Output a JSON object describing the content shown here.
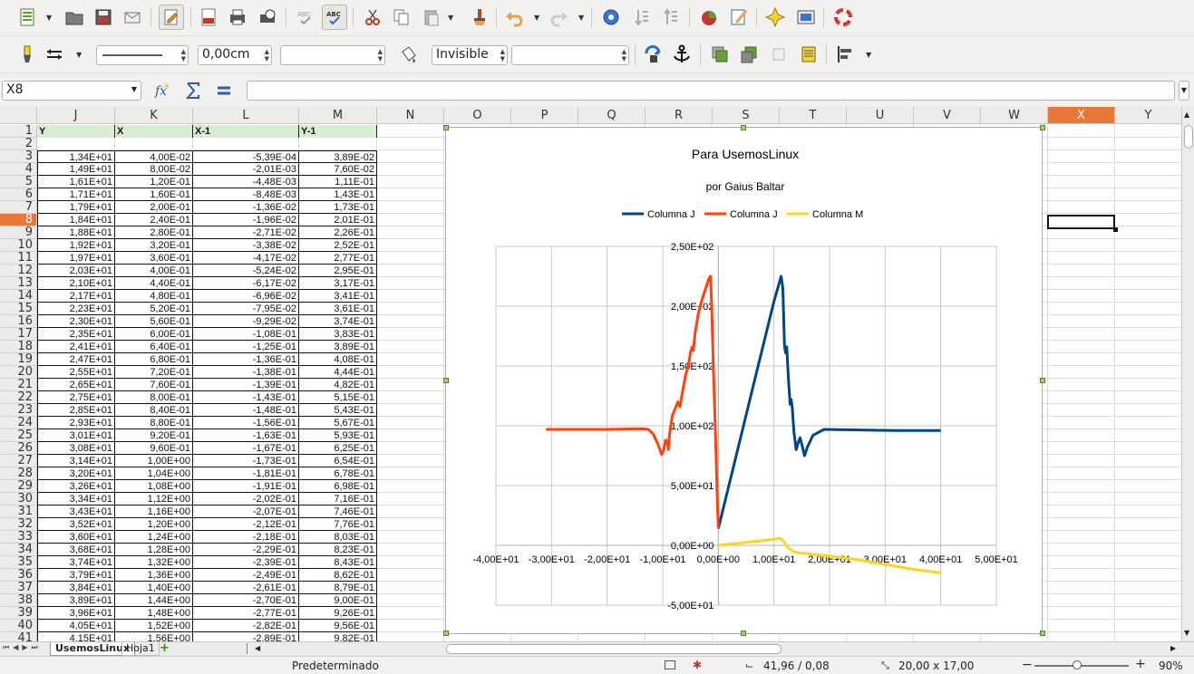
{
  "toolbar1": {
    "icons": [
      "new-document-icon",
      "open-folder-icon",
      "save-icon",
      "email-icon",
      "edit-file-icon",
      "export-pdf-icon",
      "print-icon",
      "print-preview-icon",
      "spellcheck-icon",
      "autospell-icon",
      "cut-icon",
      "copy-icon",
      "paste-icon",
      "format-paintbrush-icon",
      "undo-icon",
      "redo-icon",
      "navigator-icon",
      "sort-ascending-icon",
      "sort-descending-icon",
      "chart-icon",
      "draw-functions-icon",
      "star-gallery-icon",
      "data-sources-icon",
      "help-lifebuoy-icon"
    ]
  },
  "toolbar2": {
    "line_style_value": "",
    "line_width_value": "0,00cm",
    "line_color_value": "",
    "area_style_value": "Invisible",
    "area_fill_value": ""
  },
  "formula": {
    "name_box": "X8",
    "content": ""
  },
  "columns": [
    "J",
    "K",
    "L",
    "M",
    "N",
    "O",
    "P",
    "Q",
    "R",
    "S",
    "T",
    "U",
    "V",
    "W",
    "X",
    "Y"
  ],
  "selected_column": "X",
  "selected_row": "8",
  "headers": {
    "J": "Y",
    "K": "X",
    "L": "X-1",
    "M": "Y-1"
  },
  "rows": [
    {
      "r": "1"
    },
    {
      "r": "2"
    },
    {
      "r": "3",
      "J": "1,34E+01",
      "K": "4,00E-02",
      "L": "-5,39E-04",
      "M": "3,89E-02"
    },
    {
      "r": "4",
      "J": "1,49E+01",
      "K": "8,00E-02",
      "L": "-2,01E-03",
      "M": "7,60E-02"
    },
    {
      "r": "5",
      "J": "1,61E+01",
      "K": "1,20E-01",
      "L": "-4,48E-03",
      "M": "1,11E-01"
    },
    {
      "r": "6",
      "J": "1,71E+01",
      "K": "1,60E-01",
      "L": "-8,48E-03",
      "M": "1,43E-01"
    },
    {
      "r": "7",
      "J": "1,79E+01",
      "K": "2,00E-01",
      "L": "-1,36E-02",
      "M": "1,73E-01"
    },
    {
      "r": "8",
      "J": "1,84E+01",
      "K": "2,40E-01",
      "L": "-1,96E-02",
      "M": "2,01E-01"
    },
    {
      "r": "9",
      "J": "1,88E+01",
      "K": "2,80E-01",
      "L": "-2,71E-02",
      "M": "2,26E-01"
    },
    {
      "r": "10",
      "J": "1,92E+01",
      "K": "3,20E-01",
      "L": "-3,38E-02",
      "M": "2,52E-01"
    },
    {
      "r": "11",
      "J": "1,97E+01",
      "K": "3,60E-01",
      "L": "-4,17E-02",
      "M": "2,77E-01"
    },
    {
      "r": "12",
      "J": "2,03E+01",
      "K": "4,00E-01",
      "L": "-5,24E-02",
      "M": "2,95E-01"
    },
    {
      "r": "13",
      "J": "2,10E+01",
      "K": "4,40E-01",
      "L": "-6,17E-02",
      "M": "3,17E-01"
    },
    {
      "r": "14",
      "J": "2,17E+01",
      "K": "4,80E-01",
      "L": "-6,96E-02",
      "M": "3,41E-01"
    },
    {
      "r": "15",
      "J": "2,23E+01",
      "K": "5,20E-01",
      "L": "-7,95E-02",
      "M": "3,61E-01"
    },
    {
      "r": "16",
      "J": "2,30E+01",
      "K": "5,60E-01",
      "L": "-9,29E-02",
      "M": "3,74E-01"
    },
    {
      "r": "17",
      "J": "2,35E+01",
      "K": "6,00E-01",
      "L": "-1,08E-01",
      "M": "3,83E-01"
    },
    {
      "r": "18",
      "J": "2,41E+01",
      "K": "6,40E-01",
      "L": "-1,25E-01",
      "M": "3,89E-01"
    },
    {
      "r": "19",
      "J": "2,47E+01",
      "K": "6,80E-01",
      "L": "-1,36E-01",
      "M": "4,08E-01"
    },
    {
      "r": "20",
      "J": "2,55E+01",
      "K": "7,20E-01",
      "L": "-1,38E-01",
      "M": "4,44E-01"
    },
    {
      "r": "21",
      "J": "2,65E+01",
      "K": "7,60E-01",
      "L": "-1,39E-01",
      "M": "4,82E-01"
    },
    {
      "r": "22",
      "J": "2,75E+01",
      "K": "8,00E-01",
      "L": "-1,43E-01",
      "M": "5,15E-01"
    },
    {
      "r": "23",
      "J": "2,85E+01",
      "K": "8,40E-01",
      "L": "-1,48E-01",
      "M": "5,43E-01"
    },
    {
      "r": "24",
      "J": "2,93E+01",
      "K": "8,80E-01",
      "L": "-1,56E-01",
      "M": "5,67E-01"
    },
    {
      "r": "25",
      "J": "3,01E+01",
      "K": "9,20E-01",
      "L": "-1,63E-01",
      "M": "5,93E-01"
    },
    {
      "r": "26",
      "J": "3,08E+01",
      "K": "9,60E-01",
      "L": "-1,67E-01",
      "M": "6,25E-01"
    },
    {
      "r": "27",
      "J": "3,14E+01",
      "K": "1,00E+00",
      "L": "-1,73E-01",
      "M": "6,54E-01"
    },
    {
      "r": "28",
      "J": "3,20E+01",
      "K": "1,04E+00",
      "L": "-1,81E-01",
      "M": "6,78E-01"
    },
    {
      "r": "29",
      "J": "3,26E+01",
      "K": "1,08E+00",
      "L": "-1,91E-01",
      "M": "6,98E-01"
    },
    {
      "r": "30",
      "J": "3,34E+01",
      "K": "1,12E+00",
      "L": "-2,02E-01",
      "M": "7,16E-01"
    },
    {
      "r": "31",
      "J": "3,43E+01",
      "K": "1,16E+00",
      "L": "-2,07E-01",
      "M": "7,46E-01"
    },
    {
      "r": "32",
      "J": "3,52E+01",
      "K": "1,20E+00",
      "L": "-2,12E-01",
      "M": "7,76E-01"
    },
    {
      "r": "33",
      "J": "3,60E+01",
      "K": "1,24E+00",
      "L": "-2,18E-01",
      "M": "8,03E-01"
    },
    {
      "r": "34",
      "J": "3,68E+01",
      "K": "1,28E+00",
      "L": "-2,29E-01",
      "M": "8,23E-01"
    },
    {
      "r": "35",
      "J": "3,74E+01",
      "K": "1,32E+00",
      "L": "-2,39E-01",
      "M": "8,43E-01"
    },
    {
      "r": "36",
      "J": "3,79E+01",
      "K": "1,36E+00",
      "L": "-2,49E-01",
      "M": "8,62E-01"
    },
    {
      "r": "37",
      "J": "3,84E+01",
      "K": "1,40E+00",
      "L": "-2,61E-01",
      "M": "8,79E-01"
    },
    {
      "r": "38",
      "J": "3,89E+01",
      "K": "1,44E+00",
      "L": "-2,70E-01",
      "M": "9,00E-01"
    },
    {
      "r": "39",
      "J": "3,96E+01",
      "K": "1,48E+00",
      "L": "-2,77E-01",
      "M": "9,26E-01"
    },
    {
      "r": "40",
      "J": "4,05E+01",
      "K": "1,52E+00",
      "L": "-2,82E-01",
      "M": "9,56E-01"
    },
    {
      "r": "41",
      "J": "4,15E+01",
      "K": "1,56E+00",
      "L": "-2,89E-01",
      "M": "9,82E-01"
    }
  ],
  "chart_data": {
    "type": "line",
    "title": "Para UsemosLinux",
    "subtitle": "por Gaius Baltar",
    "legend_position": "top",
    "xlim": [
      -40,
      50
    ],
    "ylim": [
      -50,
      250
    ],
    "x_ticks": [
      "-4,00E+01",
      "-3,00E+01",
      "-2,00E+01",
      "-1,00E+01",
      "0,00E+00",
      "1,00E+01",
      "2,00E+01",
      "3,00E+01",
      "4,00E+01",
      "5,00E+01"
    ],
    "y_ticks": [
      "-5,00E+01",
      "0,00E+00",
      "5,00E+01",
      "1,00E+02",
      "1,50E+02",
      "2,00E+02",
      "2,50E+02"
    ],
    "grid": true,
    "series": [
      {
        "name": "Columna J",
        "color": "#004586",
        "points": [
          [
            0,
            14
          ],
          [
            2,
            52
          ],
          [
            4,
            90
          ],
          [
            6,
            128
          ],
          [
            8,
            166
          ],
          [
            10,
            204
          ],
          [
            11.3,
            225
          ],
          [
            11.6,
            215
          ],
          [
            11.9,
            167
          ],
          [
            12.1,
            161
          ],
          [
            12.3,
            166
          ],
          [
            12.6,
            140
          ],
          [
            12.9,
            118
          ],
          [
            13.1,
            122
          ],
          [
            13.3,
            115
          ],
          [
            13.6,
            95
          ],
          [
            14,
            80
          ],
          [
            14.3,
            85
          ],
          [
            14.7,
            90
          ],
          [
            15.1,
            83
          ],
          [
            15.5,
            75
          ],
          [
            16,
            82
          ],
          [
            17,
            92
          ],
          [
            19,
            97
          ],
          [
            25,
            96.5
          ],
          [
            32,
            96
          ],
          [
            40,
            96
          ]
        ]
      },
      {
        "name": "Columna J",
        "color": "#ff420e",
        "points": [
          [
            -31,
            97
          ],
          [
            -20,
            97
          ],
          [
            -14,
            97.5
          ],
          [
            -12.6,
            97
          ],
          [
            -11.7,
            93
          ],
          [
            -11,
            86
          ],
          [
            -10.5,
            80
          ],
          [
            -10.2,
            76
          ],
          [
            -9.8,
            80
          ],
          [
            -9.5,
            88
          ],
          [
            -9.2,
            87
          ],
          [
            -9,
            80
          ],
          [
            -8.8,
            92
          ],
          [
            -8.3,
            108
          ],
          [
            -7.7,
            115
          ],
          [
            -7.3,
            120
          ],
          [
            -6.9,
            116
          ],
          [
            -6.5,
            127
          ],
          [
            -5.9,
            142
          ],
          [
            -5.4,
            150
          ],
          [
            -5,
            162
          ],
          [
            -4.7,
            166
          ],
          [
            -4.5,
            163
          ],
          [
            -4.2,
            177
          ],
          [
            -3.6,
            194
          ],
          [
            -2.9,
            206
          ],
          [
            -2.2,
            216
          ],
          [
            -1.7,
            223
          ],
          [
            -1.4,
            225
          ],
          [
            -1.2,
            200
          ],
          [
            -0.9,
            150
          ],
          [
            -0.5,
            90
          ],
          [
            -0.2,
            40
          ],
          [
            0,
            14
          ]
        ]
      },
      {
        "name": "Columna M",
        "color": "#ffd320",
        "points": [
          [
            0,
            0
          ],
          [
            2,
            1
          ],
          [
            4,
            2
          ],
          [
            6,
            3
          ],
          [
            8,
            4
          ],
          [
            10,
            5
          ],
          [
            11,
            6
          ],
          [
            11.4,
            5
          ],
          [
            11.8,
            3
          ],
          [
            12.3,
            -1
          ],
          [
            12.8,
            -3
          ],
          [
            13.5,
            -5
          ],
          [
            14,
            -6
          ],
          [
            16,
            -7
          ],
          [
            20,
            -9
          ],
          [
            25,
            -12
          ],
          [
            30,
            -16
          ],
          [
            35,
            -20
          ],
          [
            40,
            -23
          ]
        ]
      }
    ]
  },
  "tabs": {
    "items": [
      "UsemosLinux",
      "Hoja1"
    ],
    "active": "UsemosLinux"
  },
  "status": {
    "page_style": "Predeterminado",
    "position": "41,96 / 0,08",
    "size": "20,00 x 17,00",
    "zoom": "90%"
  }
}
